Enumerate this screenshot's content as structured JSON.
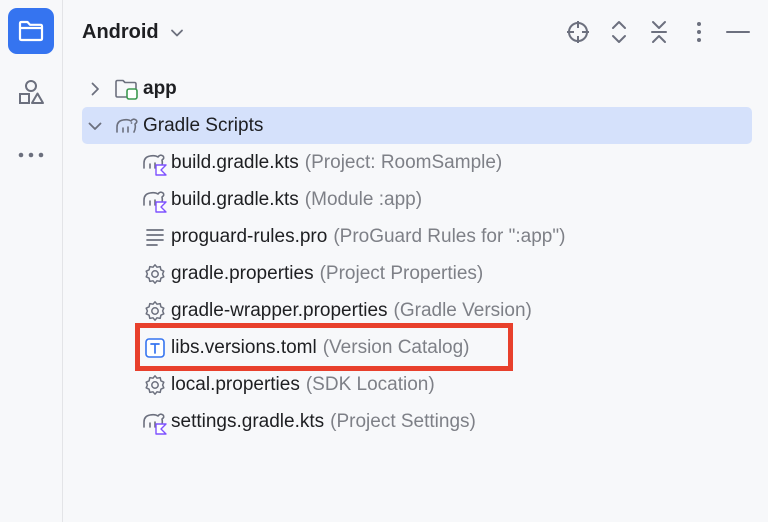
{
  "toolstrip": {
    "items": [
      {
        "name": "project-view",
        "icon": "folder-icon",
        "active": true
      },
      {
        "name": "resource-manager",
        "icon": "shapes-icon",
        "active": false
      },
      {
        "name": "more-tools",
        "icon": "more-horizontal-icon",
        "active": false
      }
    ]
  },
  "header": {
    "title": "Android",
    "actions": [
      "locate-icon",
      "expand-all-icon",
      "collapse-all-icon",
      "more-vertical-icon",
      "minimize-icon"
    ]
  },
  "tree": {
    "app": {
      "label": "app",
      "expanded": false
    },
    "gradle_scripts": {
      "label": "Gradle Scripts",
      "expanded": true,
      "selected": true
    },
    "items": [
      {
        "label": "build.gradle.kts",
        "hint": "(Project: RoomSample)",
        "icon": "gradle-kts-icon"
      },
      {
        "label": "build.gradle.kts",
        "hint": "(Module :app)",
        "icon": "gradle-kts-icon"
      },
      {
        "label": "proguard-rules.pro",
        "hint": "(ProGuard Rules for \":app\")",
        "icon": "text-lines-icon"
      },
      {
        "label": "gradle.properties",
        "hint": "(Project Properties)",
        "icon": "settings-gear-icon"
      },
      {
        "label": "gradle-wrapper.properties",
        "hint": "(Gradle Version)",
        "icon": "settings-gear-icon"
      },
      {
        "label": "libs.versions.toml",
        "hint": "(Version Catalog)",
        "icon": "toml-file-icon"
      },
      {
        "label": "local.properties",
        "hint": "(SDK Location)",
        "icon": "settings-gear-icon"
      },
      {
        "label": "settings.gradle.kts",
        "hint": "(Project Settings)",
        "icon": "gradle-kts-icon"
      }
    ]
  },
  "highlight": {
    "target": "libs.versions.toml",
    "color": "#e8402c"
  },
  "colors": {
    "accent": "#3574f0",
    "selection": "#d5e1fb",
    "hint_text": "#7e8087"
  }
}
